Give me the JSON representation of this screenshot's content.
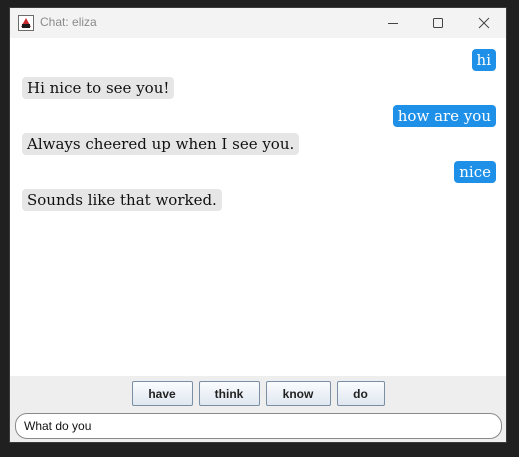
{
  "window": {
    "title": "Chat: eliza",
    "icon": "java-duke-icon"
  },
  "messages": [
    {
      "sender": "user",
      "text": "hi"
    },
    {
      "sender": "bot",
      "text": "Hi nice to see you!"
    },
    {
      "sender": "user",
      "text": "how are you"
    },
    {
      "sender": "bot",
      "text": "Always cheered up when I see you."
    },
    {
      "sender": "user",
      "text": "nice"
    },
    {
      "sender": "bot",
      "text": "Sounds like that worked."
    }
  ],
  "suggestions": [
    "have",
    "think",
    "know",
    "do"
  ],
  "input": {
    "value": "What do you"
  },
  "colors": {
    "user_bubble": "#1e90e8",
    "bot_bubble": "#e6e6e6",
    "bottom_panel": "#eeeeee"
  }
}
